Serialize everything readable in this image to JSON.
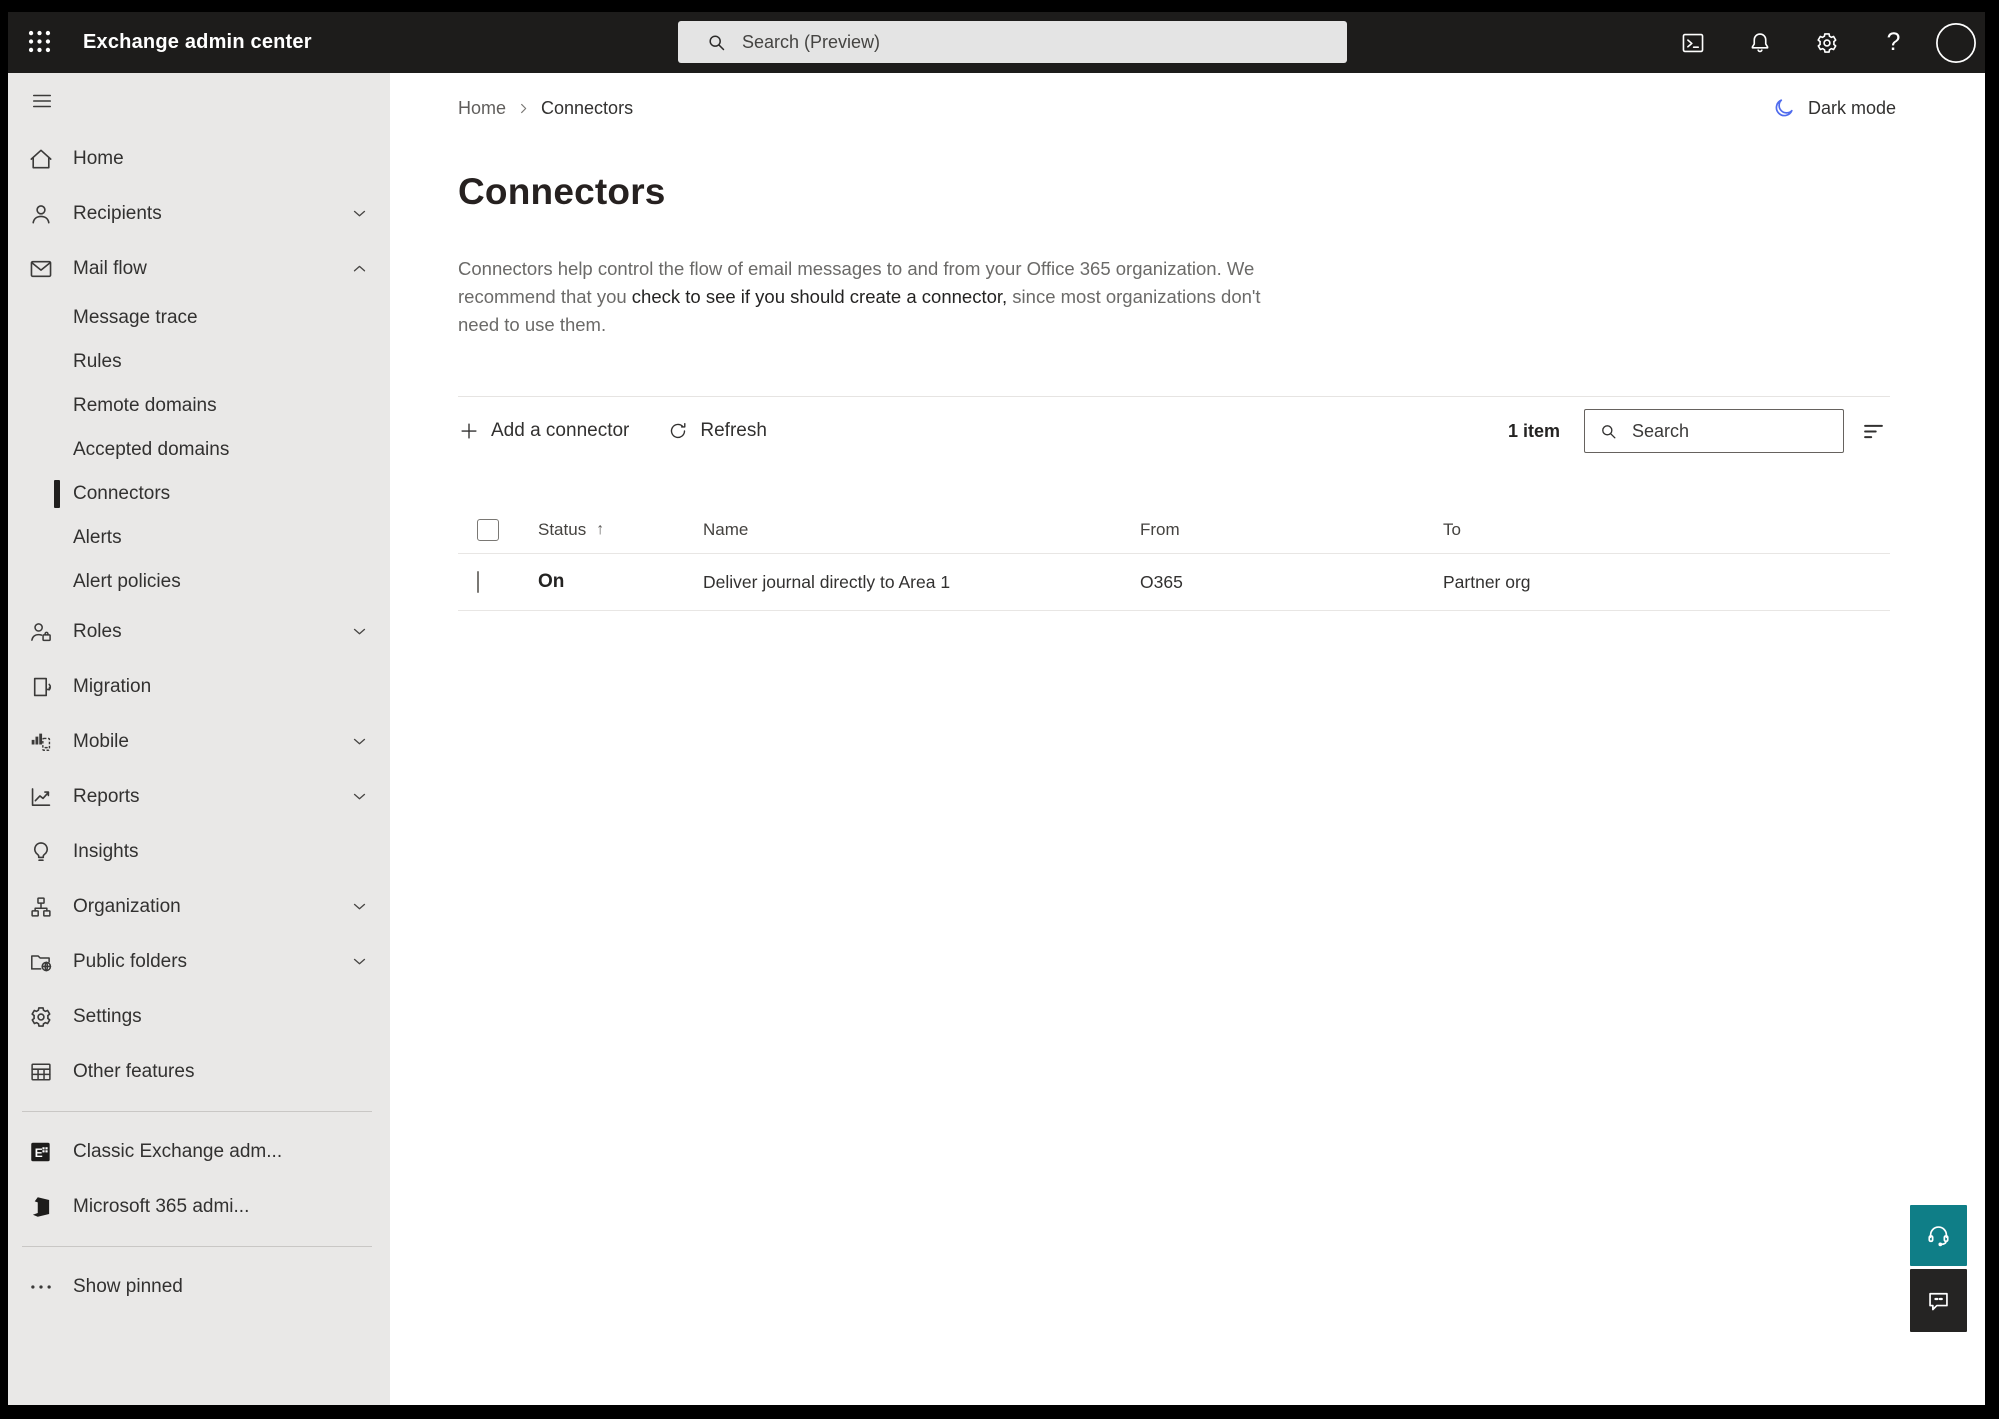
{
  "topbar": {
    "app_title": "Exchange admin center",
    "search_placeholder": "Search (Preview)",
    "icons": [
      "powershell-icon",
      "notifications-icon",
      "settings-gear-icon",
      "help-icon",
      "account-avatar"
    ]
  },
  "sidebar": {
    "items": [
      {
        "type": "item",
        "name": "home",
        "icon": "home-icon",
        "label": "Home"
      },
      {
        "type": "item",
        "name": "recipients",
        "icon": "person-icon",
        "label": "Recipients",
        "chevron": "down"
      },
      {
        "type": "item",
        "name": "mail-flow",
        "icon": "mail-icon",
        "label": "Mail flow",
        "chevron": "up"
      },
      {
        "type": "subitem",
        "name": "message-trace",
        "label": "Message trace"
      },
      {
        "type": "subitem",
        "name": "rules",
        "label": "Rules"
      },
      {
        "type": "subitem",
        "name": "remote-domains",
        "label": "Remote domains"
      },
      {
        "type": "subitem",
        "name": "accepted-domains",
        "label": "Accepted domains"
      },
      {
        "type": "subitem",
        "name": "connectors",
        "label": "Connectors",
        "selected": true
      },
      {
        "type": "subitem",
        "name": "alerts",
        "label": "Alerts"
      },
      {
        "type": "subitem",
        "name": "alert-policies",
        "label": "Alert policies"
      },
      {
        "type": "item",
        "name": "roles",
        "icon": "roles-icon",
        "label": "Roles",
        "chevron": "down"
      },
      {
        "type": "item",
        "name": "migration",
        "icon": "migration-icon",
        "label": "Migration"
      },
      {
        "type": "item",
        "name": "mobile",
        "icon": "mobile-icon",
        "label": "Mobile",
        "chevron": "down"
      },
      {
        "type": "item",
        "name": "reports",
        "icon": "reports-icon",
        "label": "Reports",
        "chevron": "down"
      },
      {
        "type": "item",
        "name": "insights",
        "icon": "insights-icon",
        "label": "Insights"
      },
      {
        "type": "item",
        "name": "organization",
        "icon": "organization-icon",
        "label": "Organization",
        "chevron": "down"
      },
      {
        "type": "item",
        "name": "public-folders",
        "icon": "public-folders-icon",
        "label": "Public folders",
        "chevron": "down"
      },
      {
        "type": "item",
        "name": "settings",
        "icon": "settings-gear-icon",
        "label": "Settings"
      },
      {
        "type": "item",
        "name": "other-features",
        "icon": "other-features-icon",
        "label": "Other features"
      },
      {
        "type": "divider"
      },
      {
        "type": "item",
        "name": "classic-exchange-admin",
        "icon": "classic-exchange-icon",
        "label": "Classic Exchange adm..."
      },
      {
        "type": "item",
        "name": "microsoft-365-admin",
        "icon": "microsoft-365-icon",
        "label": "Microsoft 365 admi..."
      },
      {
        "type": "divider"
      },
      {
        "type": "item",
        "name": "show-pinned",
        "icon": "ellipsis-icon",
        "label": "Show pinned"
      }
    ]
  },
  "breadcrumb": {
    "home": "Home",
    "current": "Connectors"
  },
  "dark_mode": {
    "label": "Dark mode"
  },
  "page": {
    "title": "Connectors",
    "description_pre": "Connectors help control the flow of email messages to and from your Office 365 organization. We recommend that you ",
    "description_link": "check to see if you should create a connector,",
    "description_post": " since most organizations don't need to use them."
  },
  "toolbar": {
    "add_label": "Add a connector",
    "refresh_label": "Refresh",
    "item_count": "1 item",
    "search_placeholder": "Search"
  },
  "table": {
    "columns": [
      {
        "label": "Status",
        "sorted": "asc"
      },
      {
        "label": "Name"
      },
      {
        "label": "From"
      },
      {
        "label": "To"
      }
    ],
    "rows": [
      {
        "status": "On",
        "name": "Deliver journal directly to Area 1",
        "from": "O365",
        "to": "Partner org"
      }
    ]
  },
  "colors": {
    "topbar_bg": "#1d1c1b",
    "sidebar_bg": "#e9e8e7",
    "moon_blue": "#4f6bed",
    "support_teal": "#0f7e87",
    "feedback_dark": "#252423"
  }
}
